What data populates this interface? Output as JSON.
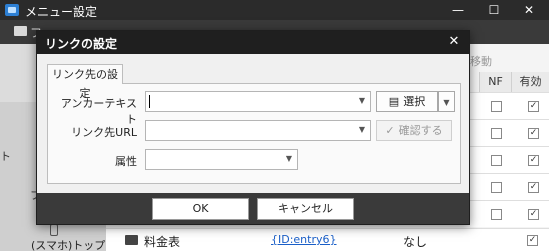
{
  "window": {
    "title": "メニュー設定",
    "toolbar_peek": "フ",
    "controls": {
      "minimize": "—",
      "maximize": "☐",
      "close": "✕"
    }
  },
  "left_panel": {
    "frag_top": "ト",
    "frag_mid": "フ",
    "item_label": "(スマホ)トップ"
  },
  "list": {
    "move_label": "移動",
    "columns": {
      "nf": "NF",
      "enabled": "有効"
    },
    "checkmark": "✓",
    "bottom_row": {
      "name": "料金表",
      "link": "{ID:entry6}",
      "value": "なし"
    }
  },
  "dialog": {
    "title": "リンクの設定",
    "close": "✕",
    "tab_label": "リンク先の設定",
    "fields": {
      "anchor_label": "アンカーテキスト",
      "anchor_value": "",
      "url_label": "リンク先URL",
      "url_value": "",
      "attr_label": "属性",
      "attr_value": ""
    },
    "select_button": "選択",
    "confirm_button": "確認する",
    "dropdown_arrow": "▼",
    "ok_button": "OK",
    "cancel_button": "キャンセル"
  }
}
